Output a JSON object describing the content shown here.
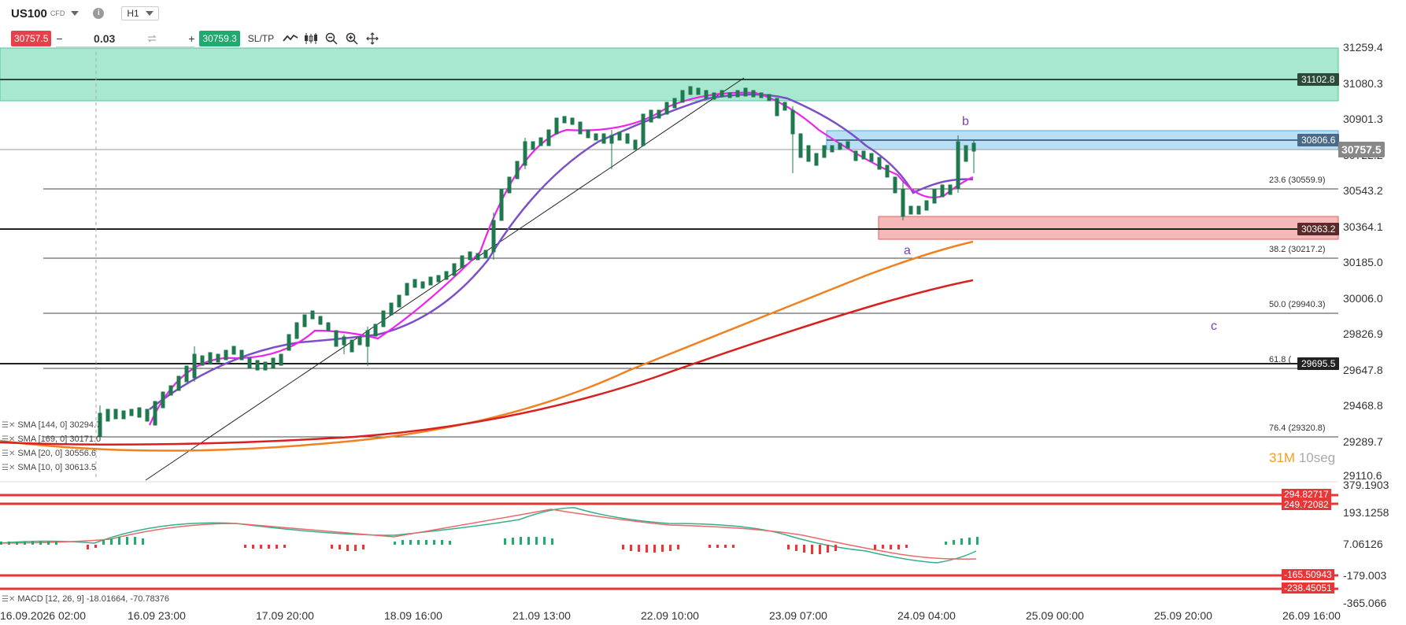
{
  "header": {
    "symbol": "US100",
    "symbol_type": "CFD",
    "timeframe": "H1"
  },
  "trade_bar": {
    "sell_price": "30757.5",
    "quantity": "0.03",
    "minus": "−",
    "plus": "+",
    "buy_price": "30759.3",
    "sltp_label": "SL/TP"
  },
  "colors": {
    "sell": "#e8404a",
    "buy": "#1faa6e",
    "sma_fast": "#ee22ee",
    "sma_slow": "#7b4fc8",
    "sma_orange": "#f08020",
    "sma_red": "#d92020",
    "supply_zone": "#a8e8d0",
    "demand_zone": "#f4b8b8",
    "order_zone": "#b8dff5"
  },
  "price_axis": [
    "31259.4",
    "31080.3",
    "30901.3",
    "30722.2",
    "30543.2",
    "30364.1",
    "30185.0",
    "30006.0",
    "29826.9",
    "29647.8",
    "29468.8",
    "29289.7",
    "29110.6"
  ],
  "price_tags": {
    "t1": "31102.8",
    "t2": "30806.6",
    "current": "30757.5",
    "t3": "30363.2",
    "t4": "29695.5"
  },
  "fib_labels": [
    "23.6 (30559.9)",
    "38.2 (30217.2)",
    "50.0 (29940.3)",
    "61.8 (",
    "76.4 (29320.8)"
  ],
  "wave_labels": {
    "a": "a",
    "b": "b",
    "c": "c"
  },
  "indicators": {
    "sma1": "SMA [144, 0] 30294.7",
    "sma2": "SMA [169, 0] 30171.0",
    "sma3": "SMA [20, 0] 30556.6",
    "sma4": "SMA [10, 0] 30613.5",
    "macd": "MACD [12, 26, 9] -18.01664, -70.78376"
  },
  "countdown": {
    "min": "31M",
    "sec": "10seg"
  },
  "macd_axis": [
    "379.1903",
    "193.1258",
    "7.06126",
    "-179.003",
    "-365.066"
  ],
  "macd_tags": {
    "t1": "294.82717",
    "t2": "249.72082",
    "t3": "-165.50943",
    "t4": "-238.45051"
  },
  "time_axis": [
    "16.09.2026 02:00",
    "16.09 23:00",
    "17.09 20:00",
    "18.09 16:00",
    "21.09 13:00",
    "22.09 10:00",
    "23.09 07:00",
    "24.09 04:00",
    "25.09 00:00",
    "25.09 20:00",
    "26.09 16:00"
  ]
}
